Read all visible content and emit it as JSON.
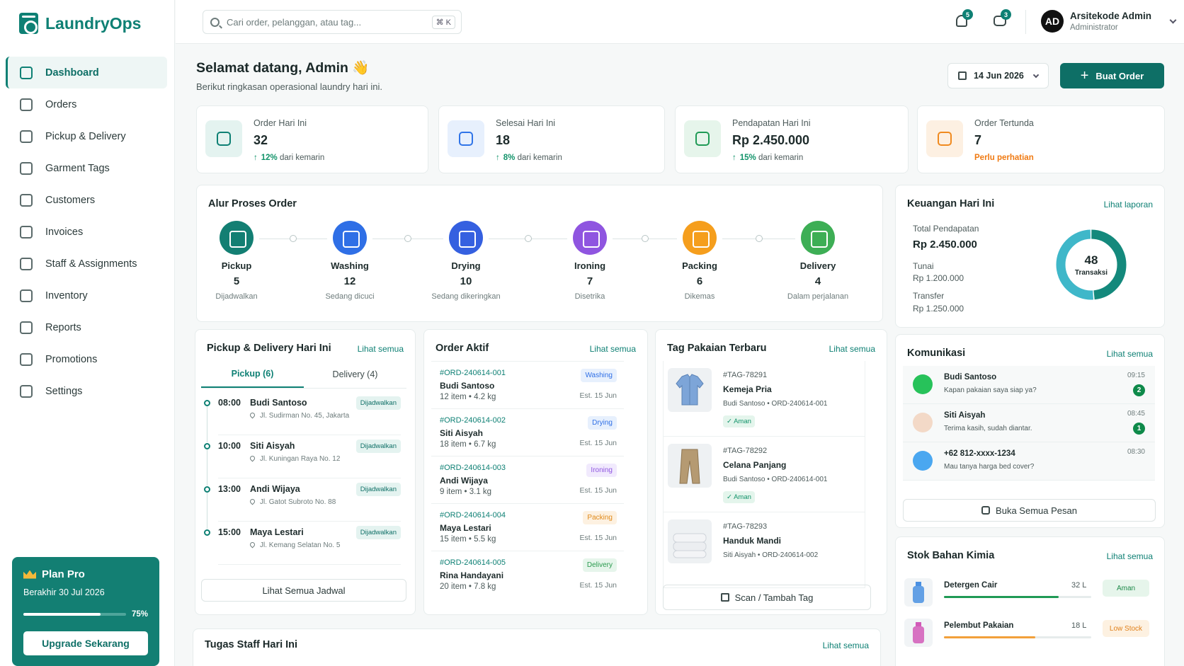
{
  "app": {
    "name": "LaundryOps"
  },
  "sidebar": {
    "items": [
      {
        "label": "Dashboard",
        "icon": "bar-chart-icon",
        "active": true
      },
      {
        "label": "Orders",
        "icon": "clipboard-icon"
      },
      {
        "label": "Pickup & Delivery",
        "icon": "truck-icon"
      },
      {
        "label": "Garment Tags",
        "icon": "tag-icon"
      },
      {
        "label": "Customers",
        "icon": "users-icon"
      },
      {
        "label": "Invoices",
        "icon": "invoice-icon"
      },
      {
        "label": "Staff & Assignments",
        "icon": "staff-icon"
      },
      {
        "label": "Inventory",
        "icon": "inventory-icon"
      },
      {
        "label": "Reports",
        "icon": "reports-icon"
      },
      {
        "label": "Promotions",
        "icon": "promo-tag-icon"
      },
      {
        "label": "Settings",
        "icon": "gear-icon"
      }
    ],
    "plan": {
      "title": "Plan Pro",
      "expiry": "Berakhir 30 Jul 2026",
      "progress_label": "75%",
      "progress": 0.75,
      "button": "Upgrade Sekarang"
    }
  },
  "topbar": {
    "search_placeholder": "Cari order, pelanggan, atau tag...",
    "shortcut": "⌘ K",
    "notifications": "5",
    "messages": "3",
    "user": {
      "initials": "AD",
      "name": "Arsitekode Admin",
      "role": "Administrator"
    }
  },
  "header": {
    "greeting": "Selamat datang, Admin 👋",
    "subtitle": "Berikut ringkasan operasional laundry hari ini.",
    "date": "14 Jun 2026",
    "create_button": "Buat Order"
  },
  "stats": [
    {
      "label": "Order Hari Ini",
      "value": "32",
      "trend_pct": "12%",
      "trend_text": " dari kemarin",
      "color": "#0e8074",
      "bg": "#e4f3f0"
    },
    {
      "label": "Selesai Hari Ini",
      "value": "18",
      "trend_pct": "8%",
      "trend_text": " dari kemarin",
      "color": "#2f74e8",
      "bg": "#e7f0fd"
    },
    {
      "label": "Pendapatan Hari Ini",
      "value": "Rp 2.450.000",
      "trend_pct": "15%",
      "trend_text": " dari kemarin",
      "color": "#1f9a55",
      "bg": "#e6f5eb"
    },
    {
      "label": "Order Tertunda",
      "value": "7",
      "note": "Perlu perhatian",
      "color": "#f08a1f",
      "bg": "#fdf0e2"
    }
  ],
  "process": {
    "title": "Alur Proses Order",
    "steps": [
      {
        "name": "Pickup",
        "count": "5",
        "sub": "Dijadwalkan",
        "color": "#137f73",
        "icon": "truck-icon"
      },
      {
        "name": "Washing",
        "count": "12",
        "sub": "Sedang dicuci",
        "color": "#2f6fe6",
        "icon": "waves-icon"
      },
      {
        "name": "Drying",
        "count": "10",
        "sub": "Sedang dikeringkan",
        "color": "#3560e0",
        "icon": "heat-icon"
      },
      {
        "name": "Ironing",
        "count": "7",
        "sub": "Disetrika",
        "color": "#8f55e0",
        "icon": "iron-icon"
      },
      {
        "name": "Packing",
        "count": "6",
        "sub": "Dikemas",
        "color": "#f59e1d",
        "icon": "box-icon"
      },
      {
        "name": "Delivery",
        "count": "4",
        "sub": "Dalam perjalanan",
        "color": "#3dae55",
        "icon": "scooter-icon"
      }
    ]
  },
  "finance": {
    "title": "Keuangan Hari Ini",
    "link": "Lihat laporan",
    "total_label": "Total Pendapatan",
    "total": "Rp 2.450.000",
    "cash_label": "Tunai",
    "cash": "Rp 1.200.000",
    "transfer_label": "Transfer",
    "transfer": "Rp 1.250.000",
    "transactions": "48",
    "transactions_label": "Transaksi",
    "segments": [
      {
        "value": 1200000,
        "color": "#14897c"
      },
      {
        "value": 1250000,
        "color": "#3fb7c9"
      }
    ]
  },
  "pickup": {
    "title": "Pickup & Delivery Hari Ini",
    "link": "Lihat semua",
    "tab_pickup": "Pickup (6)",
    "tab_delivery": "Delivery (4)",
    "rows": [
      {
        "time": "08:00",
        "name": "Budi Santoso",
        "address": "Jl. Sudirman No. 45, Jakarta",
        "status": "Dijadwalkan"
      },
      {
        "time": "10:00",
        "name": "Siti Aisyah",
        "address": "Jl. Kuningan Raya No. 12",
        "status": "Dijadwalkan"
      },
      {
        "time": "13:00",
        "name": "Andi Wijaya",
        "address": "Jl. Gatot Subroto No. 88",
        "status": "Dijadwalkan"
      },
      {
        "time": "15:00",
        "name": "Maya Lestari",
        "address": "Jl. Kemang Selatan No. 5",
        "status": "Dijadwalkan"
      }
    ],
    "button": "Lihat Semua Jadwal"
  },
  "orders": {
    "title": "Order Aktif",
    "link": "Lihat semua",
    "rows": [
      {
        "id": "#ORD-240614-001",
        "name": "Budi Santoso",
        "qty": "12 item  •  4.2 kg",
        "status": "Washing",
        "est": "Est. 15 Jun",
        "fg": "#2f6fe6",
        "bg": "#e7f0fd"
      },
      {
        "id": "#ORD-240614-002",
        "name": "Siti Aisyah",
        "qty": "18 item  •  6.7 kg",
        "status": "Drying",
        "est": "Est. 15 Jun",
        "fg": "#2f6fe6",
        "bg": "#e7f0fd"
      },
      {
        "id": "#ORD-240614-003",
        "name": "Andi Wijaya",
        "qty": "9 item  •  3.1 kg",
        "status": "Ironing",
        "est": "Est. 15 Jun",
        "fg": "#8f55e0",
        "bg": "#f1eafd"
      },
      {
        "id": "#ORD-240614-004",
        "name": "Maya Lestari",
        "qty": "15 item  •  5.5 kg",
        "status": "Packing",
        "est": "Est. 15 Jun",
        "fg": "#e08a1a",
        "bg": "#fdf1e1"
      },
      {
        "id": "#ORD-240614-005",
        "name": "Rina Handayani",
        "qty": "20 item  •  7.8 kg",
        "status": "Delivery",
        "est": "Est. 15 Jun",
        "fg": "#2a9a4e",
        "bg": "#e6f5eb"
      }
    ]
  },
  "tags": {
    "title": "Tag Pakaian Terbaru",
    "link": "Lihat semua",
    "rows": [
      {
        "id": "#TAG-78291",
        "name": "Kemeja Pria",
        "sub": "Budi Santoso  •  ORD-240614-001",
        "status": "✓ Aman",
        "img": "shirt"
      },
      {
        "id": "#TAG-78292",
        "name": "Celana Panjang",
        "sub": "Budi Santoso  •  ORD-240614-001",
        "status": "✓ Aman",
        "img": "pants"
      },
      {
        "id": "#TAG-78293",
        "name": "Handuk Mandi",
        "sub": "Siti Aisyah  •  ORD-240614-002",
        "status": "",
        "img": "towel"
      }
    ],
    "button": "Scan / Tambah Tag"
  },
  "comms": {
    "title": "Komunikasi",
    "link": "Lihat semua",
    "rows": [
      {
        "name": "Budi Santoso",
        "msg": "Kapan pakaian saya siap ya?",
        "time": "09:15",
        "unread": "2",
        "type": "whatsapp"
      },
      {
        "name": "Siti Aisyah",
        "msg": "Terima kasih, sudah diantar.",
        "time": "08:45",
        "unread": "1",
        "type": "photo"
      },
      {
        "name": "+62 812-xxxx-1234",
        "msg": "Mau tanya harga bed cover?",
        "time": "08:30",
        "unread": "",
        "type": "phone"
      }
    ],
    "button": "Buka Semua Pesan"
  },
  "stock": {
    "title": "Stok Bahan Kimia",
    "link": "Lihat semua",
    "rows": [
      {
        "name": "Detergen Cair",
        "qty": "32 L",
        "status": "Aman",
        "level": 0.78,
        "bar": "#1f9a55",
        "fg": "#1f8a4a",
        "bg": "#e6f5eb",
        "color": "#4a90e2"
      },
      {
        "name": "Pelembut Pakaian",
        "qty": "18 L",
        "status": "Low Stock",
        "level": 0.62,
        "bar": "#f2a03a",
        "fg": "#e0801a",
        "bg": "#fdf1e1",
        "color": "#d25ab8"
      }
    ]
  },
  "staff": {
    "title": "Tugas Staff Hari Ini",
    "link": "Lihat semua"
  }
}
